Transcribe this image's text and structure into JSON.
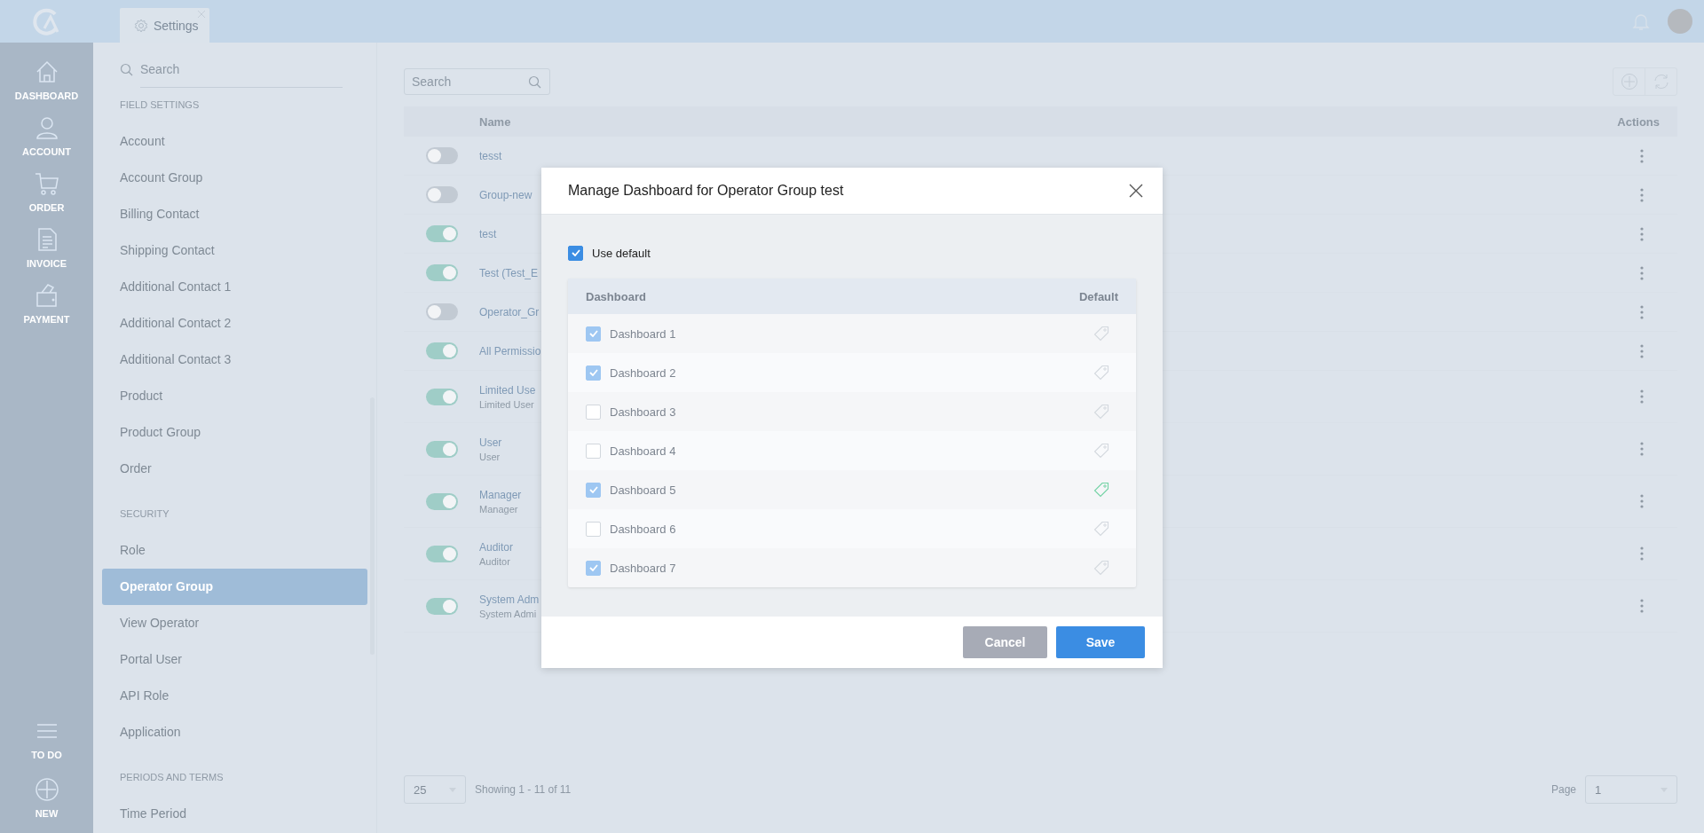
{
  "top_bar": {
    "tabs": [
      {
        "label": "Settings",
        "selected": true
      }
    ]
  },
  "nav": {
    "items": [
      {
        "label": "DASHBOARD",
        "kind": "home"
      },
      {
        "label": "ACCOUNT",
        "kind": "person"
      },
      {
        "label": "ORDER",
        "kind": "cart"
      },
      {
        "label": "INVOICE",
        "kind": "document"
      },
      {
        "label": "PAYMENT",
        "kind": "wallet"
      }
    ],
    "bottom_items": [
      {
        "label": "TO DO",
        "kind": "lines"
      },
      {
        "label": "NEW",
        "kind": "plus"
      }
    ]
  },
  "sidebar": {
    "search": {
      "placeholder": "Search"
    },
    "sections": [
      {
        "heading": "FIELD SETTINGS",
        "items": [
          {
            "label": "Account",
            "selected": false
          },
          {
            "label": "Account Group",
            "selected": false
          },
          {
            "label": "Billing Contact",
            "selected": false
          },
          {
            "label": "Shipping Contact",
            "selected": false
          },
          {
            "label": "Additional Contact 1",
            "selected": false
          },
          {
            "label": "Additional Contact 2",
            "selected": false
          },
          {
            "label": "Additional Contact 3",
            "selected": false
          },
          {
            "label": "Product",
            "selected": false
          },
          {
            "label": "Product Group",
            "selected": false
          },
          {
            "label": "Order",
            "selected": false
          }
        ]
      },
      {
        "heading": "SECURITY",
        "items": [
          {
            "label": "Role",
            "selected": false
          },
          {
            "label": "Operator Group",
            "selected": true
          },
          {
            "label": "View Operator",
            "selected": false
          },
          {
            "label": "Portal User",
            "selected": false
          },
          {
            "label": "API Role",
            "selected": false
          },
          {
            "label": "Application",
            "selected": false
          }
        ]
      },
      {
        "heading": "PERIODS AND TERMS",
        "items": [
          {
            "label": "Time Period",
            "selected": false
          }
        ]
      }
    ]
  },
  "main": {
    "search": {
      "placeholder": "Search"
    },
    "table": {
      "columns": [
        "Name",
        "Actions"
      ],
      "rows": [
        {
          "name": "tesst",
          "on": false
        },
        {
          "name": "Group-new",
          "on": false
        },
        {
          "name": "test",
          "on": true
        },
        {
          "name": "Test (Test_E",
          "on": true
        },
        {
          "name": "Operator_Gr",
          "on": false
        },
        {
          "name": "All Permissio",
          "on": true
        },
        {
          "name": "Limited Use",
          "subtitle": "Limited User",
          "on": true
        },
        {
          "name": "User",
          "subtitle": "User",
          "on": true
        },
        {
          "name": "Manager",
          "subtitle": "Manager",
          "on": true
        },
        {
          "name": "Auditor",
          "subtitle": "Auditor",
          "on": true
        },
        {
          "name": "System Adm",
          "subtitle": "System Admi",
          "on": true
        }
      ]
    },
    "footer": {
      "page_size": "25",
      "showing": "Showing 1 - 11 of 11",
      "page_label": "Page",
      "page": "1"
    }
  },
  "modal": {
    "title": "Manage Dashboard for Operator Group test",
    "use_default": {
      "label": "Use default",
      "checked": true
    },
    "table": {
      "columns": [
        "Dashboard",
        "Default"
      ],
      "rows": [
        {
          "label": "Dashboard 1",
          "checked": true,
          "default": false
        },
        {
          "label": "Dashboard 2",
          "checked": true,
          "default": false
        },
        {
          "label": "Dashboard 3",
          "checked": false,
          "default": false
        },
        {
          "label": "Dashboard 4",
          "checked": false,
          "default": false
        },
        {
          "label": "Dashboard 5",
          "checked": true,
          "default": true
        },
        {
          "label": "Dashboard 6",
          "checked": false,
          "default": false
        },
        {
          "label": "Dashboard 7",
          "checked": true,
          "default": false
        }
      ]
    },
    "buttons": [
      {
        "label": "Cancel",
        "kind": "secondary"
      },
      {
        "label": "Save",
        "kind": "primary"
      }
    ]
  }
}
